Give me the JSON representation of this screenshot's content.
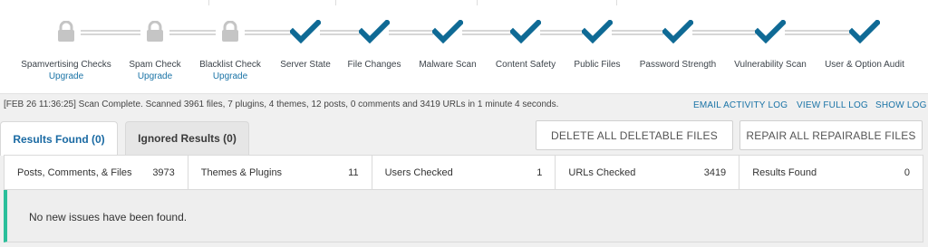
{
  "stages": [
    {
      "label": "Spamvertising Checks",
      "status": "locked",
      "upgrade": "Upgrade",
      "icon": "lock-icon"
    },
    {
      "label": "Spam Check",
      "status": "locked",
      "upgrade": "Upgrade",
      "icon": "lock-icon"
    },
    {
      "label": "Blacklist Check",
      "status": "locked",
      "upgrade": "Upgrade",
      "icon": "lock-icon"
    },
    {
      "label": "Server State",
      "status": "complete",
      "icon": "checkmark-icon"
    },
    {
      "label": "File Changes",
      "status": "complete",
      "icon": "checkmark-icon"
    },
    {
      "label": "Malware Scan",
      "status": "complete",
      "icon": "checkmark-icon"
    },
    {
      "label": "Content Safety",
      "status": "complete",
      "icon": "checkmark-icon"
    },
    {
      "label": "Public Files",
      "status": "complete",
      "icon": "checkmark-icon"
    },
    {
      "label": "Password Strength",
      "status": "complete",
      "icon": "checkmark-icon"
    },
    {
      "label": "Vulnerability Scan",
      "status": "complete",
      "icon": "checkmark-icon"
    },
    {
      "label": "User & Option Audit",
      "status": "complete",
      "icon": "checkmark-icon"
    }
  ],
  "colors": {
    "check": "#0f6a95",
    "lock": "#c5c5c5",
    "link": "#1a73a6",
    "notice_accent": "#2bbf9b"
  },
  "scan_status": "[FEB 26 11:36:25] Scan Complete. Scanned 3961 files, 7 plugins, 4 themes, 12 posts, 0 comments and 3419 URLs in 1 minute 4 seconds.",
  "links": {
    "email_activity_log": "EMAIL ACTIVITY LOG",
    "view_full_log": "VIEW FULL LOG",
    "show_log": "SHOW LOG"
  },
  "tabs": {
    "results_found": "Results Found (0)",
    "ignored_results": "Ignored Results (0)"
  },
  "actions": {
    "delete_all": "DELETE ALL DELETABLE FILES",
    "repair_all": "REPAIR ALL REPAIRABLE FILES"
  },
  "summary": [
    {
      "label": "Posts, Comments, & Files",
      "value": "3973"
    },
    {
      "label": "Themes & Plugins",
      "value": "11"
    },
    {
      "label": "Users Checked",
      "value": "1"
    },
    {
      "label": "URLs Checked",
      "value": "3419"
    },
    {
      "label": "Results Found",
      "value": "0"
    }
  ],
  "notice": "No new issues have been found."
}
